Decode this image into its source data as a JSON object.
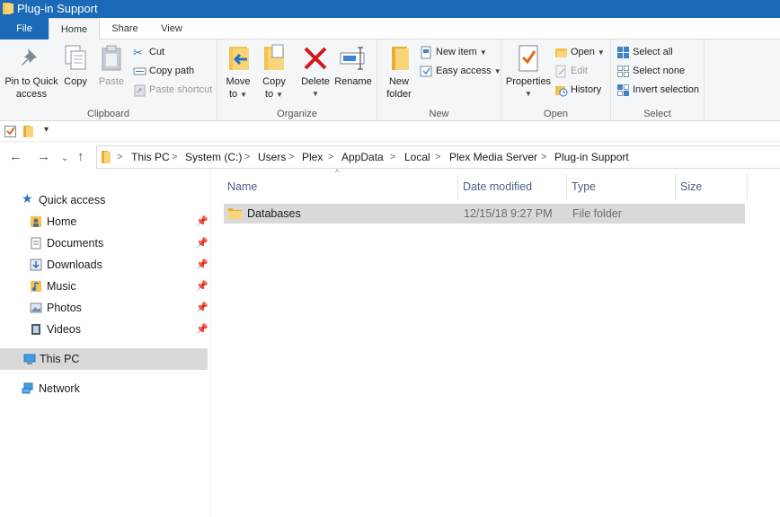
{
  "window": {
    "title": "Plug-in Support"
  },
  "tabs": {
    "file": "File",
    "home": "Home",
    "share": "Share",
    "view": "View"
  },
  "ribbon": {
    "clipboard": {
      "label": "Clipboard",
      "pin_line1": "Pin to Quick",
      "pin_line2": "access",
      "copy": "Copy",
      "paste": "Paste",
      "cut": "Cut",
      "copy_path": "Copy path",
      "paste_shortcut": "Paste shortcut"
    },
    "organize": {
      "label": "Organize",
      "move_line1": "Move",
      "move_line2": "to",
      "copy_line1": "Copy",
      "copy_line2": "to",
      "delete": "Delete",
      "rename": "Rename"
    },
    "new": {
      "label": "New",
      "folder_line1": "New",
      "folder_line2": "folder",
      "new_item": "New item",
      "easy_access": "Easy access"
    },
    "open": {
      "label": "Open",
      "properties": "Properties",
      "open": "Open",
      "edit": "Edit",
      "history": "History"
    },
    "select": {
      "label": "Select",
      "select_all": "Select all",
      "select_none": "Select none",
      "invert": "Invert selection"
    }
  },
  "breadcrumb": [
    "This PC",
    "System (C:)",
    "Users",
    "Plex",
    "AppData",
    "Local",
    "Plex Media Server",
    "Plug-in Support"
  ],
  "sidebar": {
    "quick_access": "Quick access",
    "items": [
      {
        "label": "Home",
        "icon": "home-folder-icon"
      },
      {
        "label": "Documents",
        "icon": "documents-icon"
      },
      {
        "label": "Downloads",
        "icon": "downloads-icon"
      },
      {
        "label": "Music",
        "icon": "music-icon"
      },
      {
        "label": "Photos",
        "icon": "photos-icon"
      },
      {
        "label": "Videos",
        "icon": "videos-icon"
      }
    ],
    "this_pc": "This PC",
    "network": "Network"
  },
  "columns": {
    "name": "Name",
    "date": "Date modified",
    "type": "Type",
    "size": "Size"
  },
  "files": [
    {
      "name": "Databases",
      "date": "12/15/18 9:27 PM",
      "type": "File folder",
      "size": ""
    }
  ],
  "colors": {
    "accent": "#1a6ab8",
    "folder": "#f5c14f",
    "selection": "#d9d9d9",
    "header_text": "#4d6082"
  }
}
